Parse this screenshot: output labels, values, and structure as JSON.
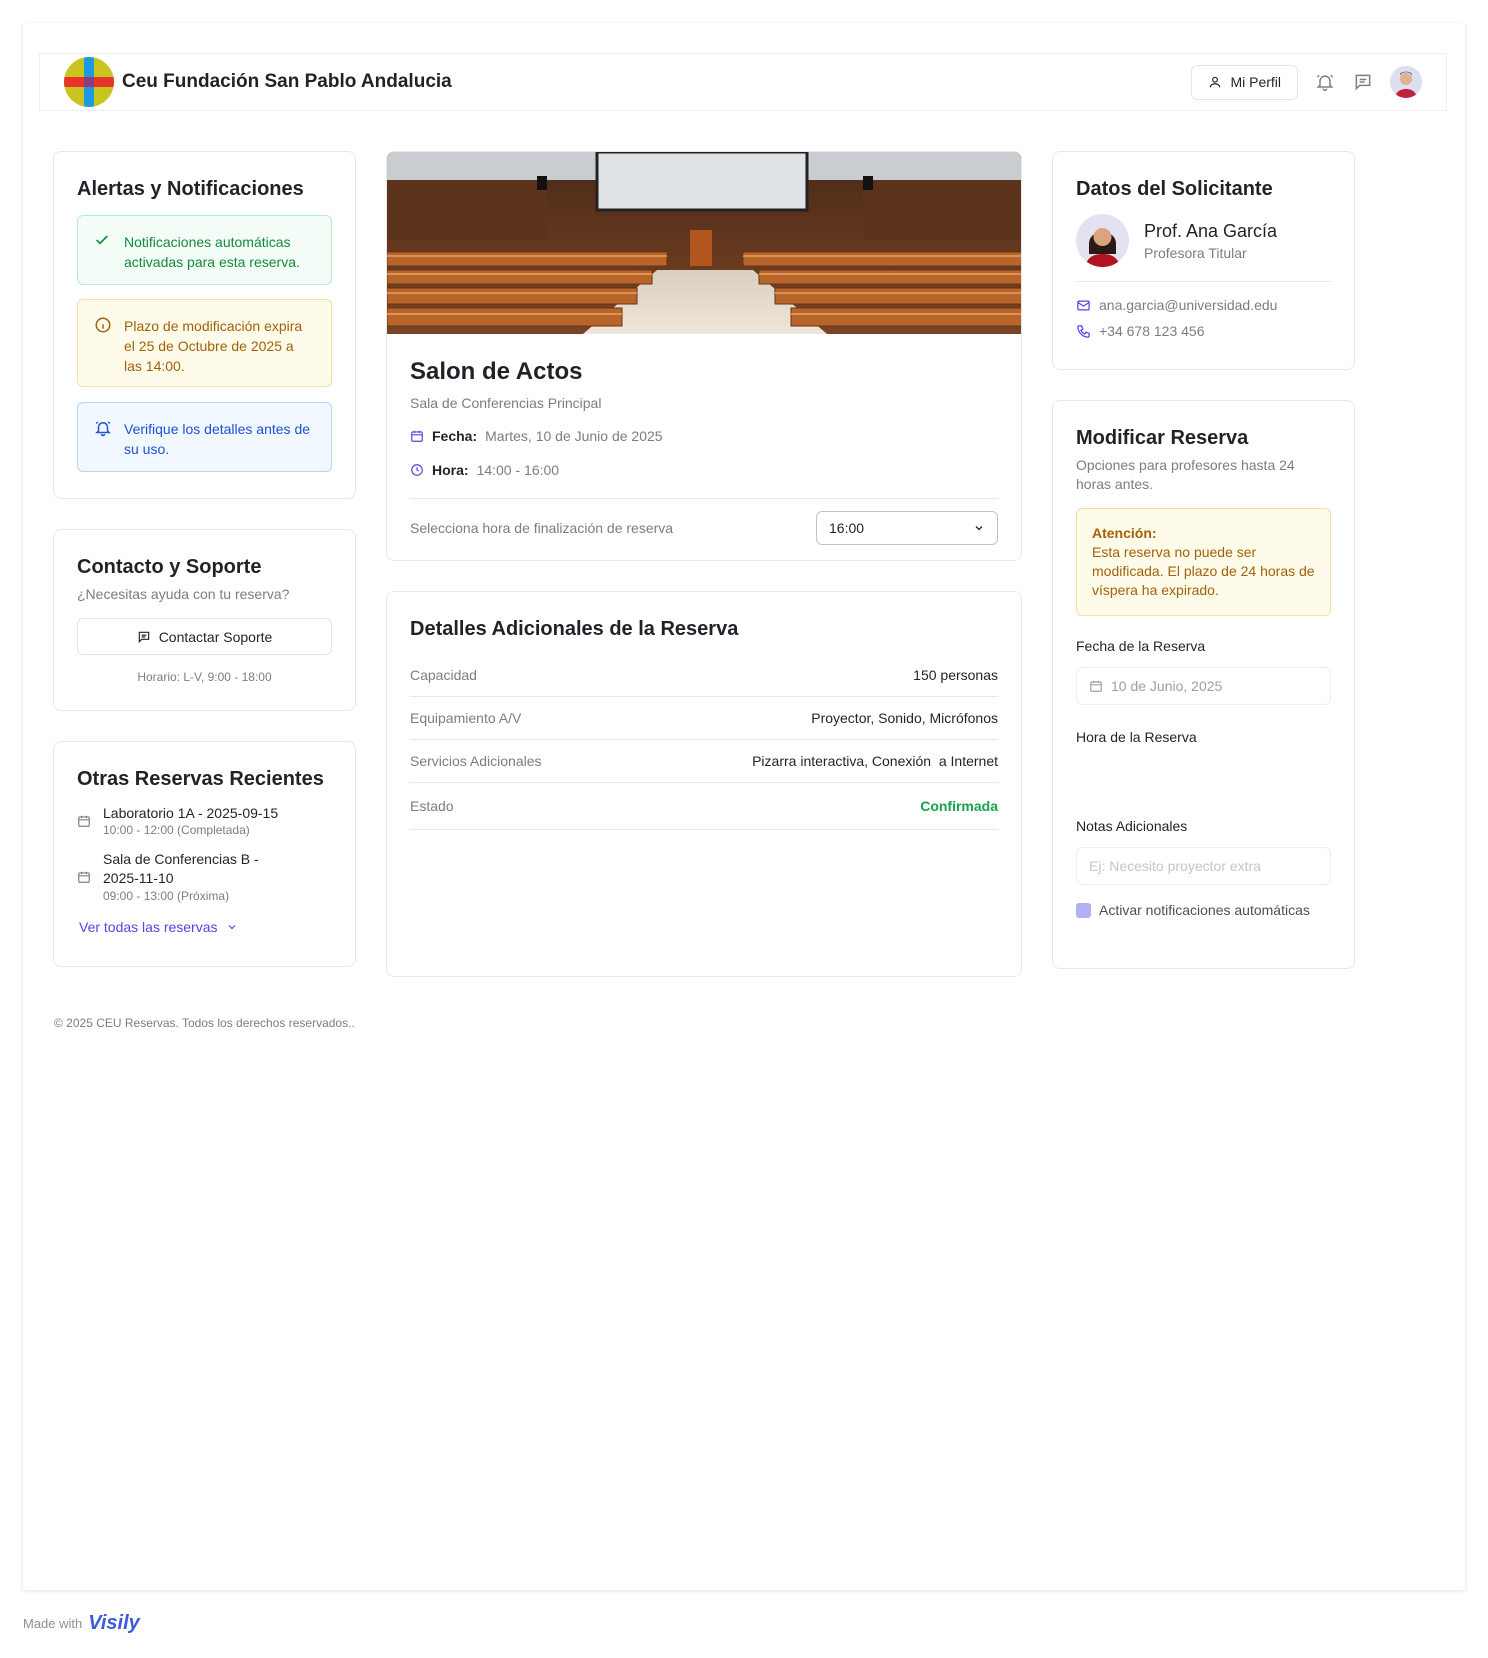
{
  "header": {
    "brand": "Ceu Fundación San Pablo Andalucia",
    "profile_label": "Mi Perfil"
  },
  "alerts": {
    "title": "Alertas y Notificaciones",
    "items": [
      {
        "text": "Notificaciones automáticas activadas para esta reserva.",
        "icon": "check-icon"
      },
      {
        "text": "Plazo de modificación expira el 25 de Octubre de 2025 a las 14:00.",
        "icon": "info-circle-icon"
      },
      {
        "text": "Verifique los detalles antes de su uso.",
        "icon": "bell-icon"
      }
    ]
  },
  "support": {
    "title": "Contacto y Soporte",
    "subtitle": "¿Necesitas ayuda con tu reserva?",
    "button": "Contactar Soporte",
    "hours": "Horario: L-V, 9:00 - 18:00"
  },
  "recent": {
    "title": "Otras Reservas Recientes",
    "items": [
      {
        "name": "Laboratorio 1A - 2025-09-15",
        "time": "10:00 - 12:00 (Completada)"
      },
      {
        "name": "Sala de Conferencias B - 2025-11-10",
        "time": "09:00 - 13:00 (Próxima)"
      }
    ],
    "view_all": "Ver todas las reservas"
  },
  "room": {
    "name": "Salon de Actos",
    "subtitle": "Sala de Conferencias Principal",
    "date_label": "Fecha:",
    "date_value": "Martes, 10 de Junio de 2025",
    "time_label": "Hora:",
    "time_value": "14:00 - 16:00",
    "end_label": "Selecciona hora de finalización de reserva",
    "end_value": "16:00"
  },
  "details": {
    "title": "Detalles Adicionales de la Reserva",
    "rows": [
      {
        "k": "Capacidad",
        "v": "150 personas"
      },
      {
        "k": "Equipamiento A/V",
        "v": "Proyector, Sonido, Micrófonos"
      },
      {
        "k": "Servicios Adicionales",
        "v": "Pizarra interactiva, Conexión  a Internet"
      },
      {
        "k": "Estado",
        "v": "Confirmada"
      }
    ],
    "status_color": "#16a34a"
  },
  "applicant": {
    "title": "Datos del Solicitante",
    "name": "Prof. Ana García",
    "role": "Profesora Titular",
    "email": "ana.garcia@universidad.edu",
    "phone": "+34 678 123 456"
  },
  "modify": {
    "title": "Modificar Reserva",
    "subtitle": "Opciones para profesores hasta 24 horas antes.",
    "warn_title": "Atención:",
    "warn_text": "Esta reserva no puede ser modificada. El plazo de 24 horas de víspera ha expirado.",
    "date_label": "Fecha de la Reserva",
    "date_value": "10 de Junio, 2025",
    "hour_label": "Hora de la Reserva",
    "notes_label": "Notas Adicionales",
    "notes_placeholder": "Ej: Necesito proyector extra",
    "notify_label": "Activar notificaciones automáticas"
  },
  "footer": {
    "copyright": "© 2025 CEU Reservas. Todos los derechos reservados..",
    "made_with": "Made with",
    "visily": "Visily"
  },
  "colors": {
    "accent": "#4f46e5",
    "link": "#4f46e5"
  }
}
